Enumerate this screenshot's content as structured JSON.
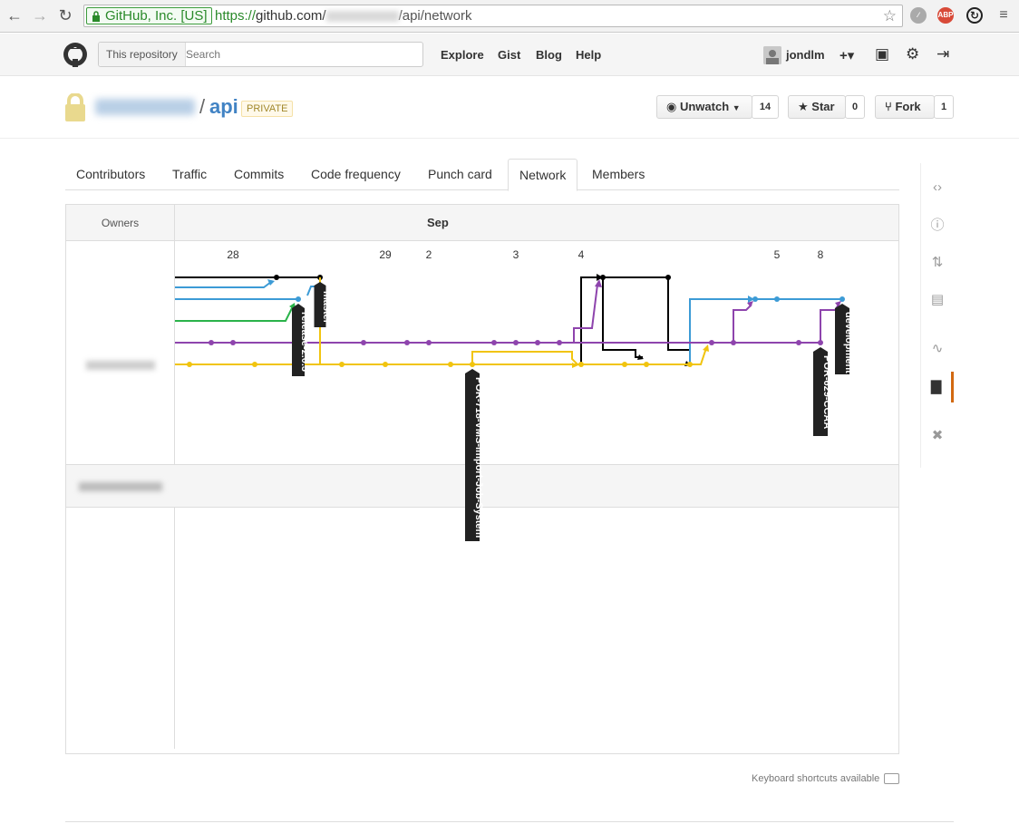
{
  "browser": {
    "ev_label": "GitHub, Inc. [US]",
    "url_scheme": "https://",
    "url_host": "github.com/",
    "url_path": "/api/network",
    "abp_label": "ABP"
  },
  "header": {
    "search_scope": "This repository",
    "search_placeholder": "Search",
    "nav": [
      "Explore",
      "Gist",
      "Blog",
      "Help"
    ],
    "username": "jondlm",
    "plus_label": "+▾"
  },
  "repo": {
    "separator": "/",
    "name": "api",
    "visibility": "PRIVATE",
    "watch_label": "Unwatch",
    "watch_count": "14",
    "star_label": "Star",
    "star_count": "0",
    "fork_label": "Fork",
    "fork_count": "1"
  },
  "tabs": [
    "Contributors",
    "Traffic",
    "Commits",
    "Code frequency",
    "Punch card",
    "Network",
    "Members"
  ],
  "active_tab": "Network",
  "network": {
    "owners_header": "Owners",
    "month": "Sep",
    "day_labels": [
      "28",
      "29",
      "2",
      "3",
      "4",
      "5",
      "8"
    ],
    "branches": [
      "master",
      "release-2.0.3",
      "POR-718-VMS-Import-Job-System",
      "POR-629-CCAA",
      "development"
    ],
    "colors": {
      "black": "#000000",
      "blue": "#3c9bd6",
      "green": "#2ab34a",
      "purple": "#8e44ad",
      "yellow": "#f1c40f"
    }
  },
  "footer": {
    "keyboard_note": "Keyboard shortcuts available"
  }
}
